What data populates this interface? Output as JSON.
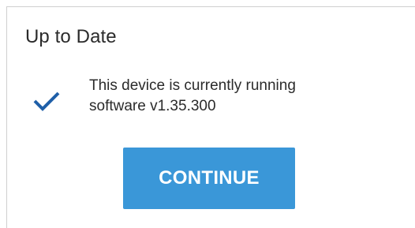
{
  "dialog": {
    "title": "Up to Date",
    "message_line1": "This device is currently running",
    "message_line2": "software v1.35.300",
    "status_icon": "checkmark-icon",
    "continue_label": "CONTINUE"
  },
  "colors": {
    "accent": "#3a97d8",
    "checkmark": "#1f5fa8",
    "text": "#2b2b2b"
  }
}
